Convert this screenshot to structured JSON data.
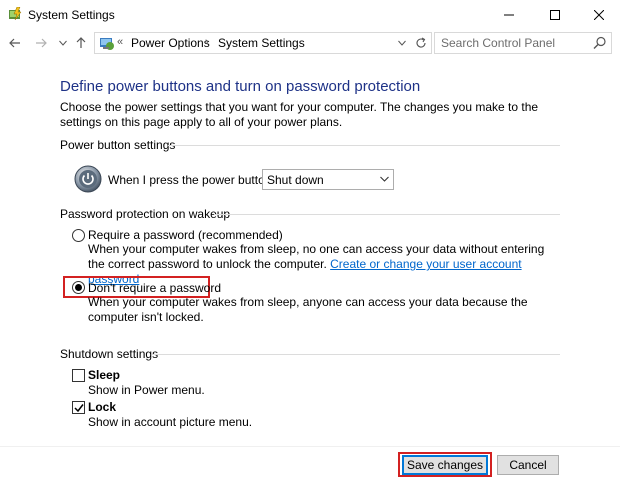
{
  "window": {
    "title": "System Settings"
  },
  "address_bar": {
    "overflow_chevron": "«",
    "crumbs": [
      "Power Options",
      "System Settings"
    ],
    "separator": "›"
  },
  "search": {
    "placeholder": "Search Control Panel"
  },
  "content": {
    "heading": "Define power buttons and turn on password protection",
    "intro": "Choose the power settings that you want for your computer. The changes you make to the settings on this page apply to all of your power plans.",
    "power_button_group": {
      "label": "Power button settings",
      "row_label": "When I press the power button:",
      "selected_value": "Shut down"
    },
    "password_group": {
      "label": "Password protection on wakeup",
      "options": [
        {
          "label": "Require a password (recommended)",
          "description": "When your computer wakes from sleep, no one can access your data without entering the correct password to unlock the computer.",
          "link_text": "Create or change your user account password",
          "selected": false
        },
        {
          "label": "Don't require a password",
          "description": "When your computer wakes from sleep, anyone can access your data because the computer isn't locked.",
          "selected": true
        }
      ]
    },
    "shutdown_group": {
      "label": "Shutdown settings",
      "items": [
        {
          "label": "Sleep",
          "description": "Show in Power menu.",
          "checked": false
        },
        {
          "label": "Lock",
          "description": "Show in account picture menu.",
          "checked": true
        }
      ]
    }
  },
  "footer": {
    "save_label": "Save changes",
    "cancel_label": "Cancel"
  },
  "colors": {
    "heading": "#1e3287",
    "link": "#0066cc",
    "highlight": "#d32121",
    "accent": "#0078d7"
  }
}
